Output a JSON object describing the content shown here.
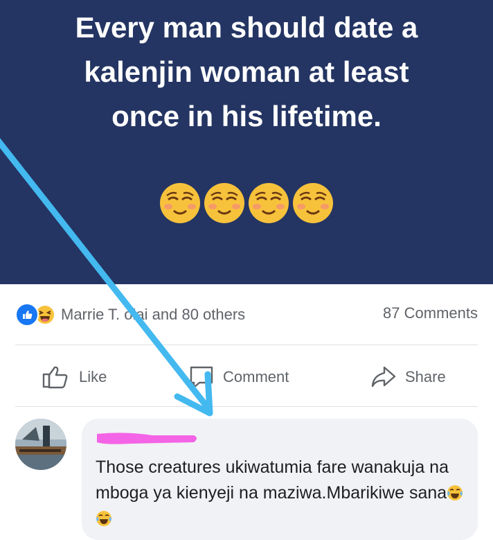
{
  "post": {
    "title_lines": [
      "Every man should date a",
      "kalenjin woman at least",
      "once in his lifetime."
    ],
    "emojis": [
      "relieved-face",
      "relieved-face",
      "relieved-face",
      "relieved-face"
    ]
  },
  "reactions": {
    "icons": [
      "like-reaction-icon",
      "haha-reaction-icon"
    ],
    "people_text": "Marrie T. olai and 80 others",
    "comment_count": "87 Comments"
  },
  "actions": {
    "like_label": "Like",
    "comment_label": "Comment",
    "share_label": "Share"
  },
  "comment": {
    "text": "Those creatures ukiwatumia fare wanakuja na mboga ya kienyeji na maziwa.Mbarikiwe sana",
    "emojis": [
      "face-with-tears-of-joy",
      "face-with-tears-of-joy"
    ]
  },
  "colors": {
    "banner_bg": "#243563",
    "arrow": "#43b9f0",
    "redaction": "#f464e6",
    "fb_blue": "#1877f2"
  }
}
